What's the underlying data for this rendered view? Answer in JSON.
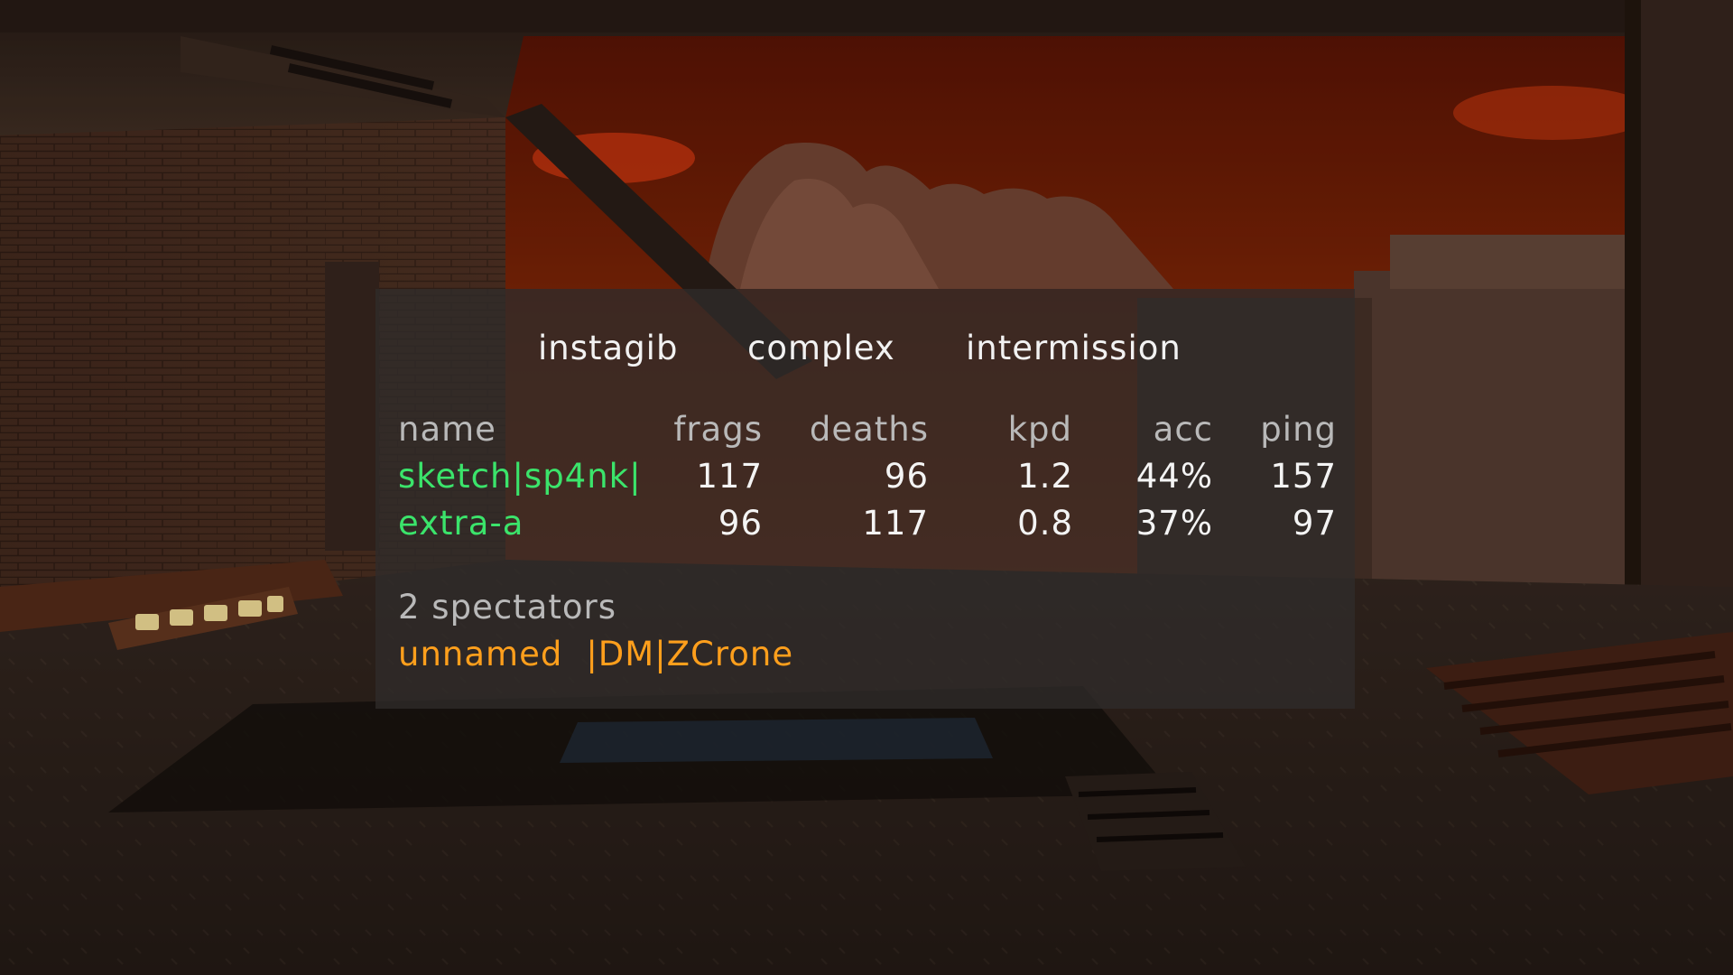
{
  "scoreboard": {
    "mode": "instagib",
    "map": "complex",
    "state": "intermission",
    "columns": {
      "name": "name",
      "frags": "frags",
      "deaths": "deaths",
      "kpd": "kpd",
      "acc": "acc",
      "ping": "ping"
    },
    "players": [
      {
        "name": "sketch|sp4nk|",
        "frags": "117",
        "deaths": "96",
        "kpd": "1.2",
        "acc": "44%",
        "ping": "157"
      },
      {
        "name": "extra-a",
        "frags": "96",
        "deaths": "117",
        "kpd": "0.8",
        "acc": "37%",
        "ping": "97"
      }
    ],
    "spectator_count": "2 spectators",
    "spectators": [
      "unnamed",
      "|DM|ZCrone"
    ]
  },
  "colors": {
    "player_name": "#3be46b",
    "spectator_name": "#ff9f1c",
    "header_text": "#b9b9b9",
    "panel_bg": "#302c2a"
  }
}
